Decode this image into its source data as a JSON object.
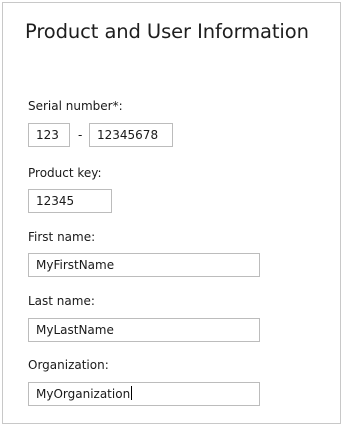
{
  "window": {
    "title": "Product and User Information"
  },
  "serial": {
    "label": "Serial number*:",
    "part1": "123",
    "separator": "-",
    "part2": "12345678"
  },
  "product_key": {
    "label": "Product key:",
    "value": "12345"
  },
  "first_name": {
    "label": "First name:",
    "value": "MyFirstName"
  },
  "last_name": {
    "label": "Last name:",
    "value": "MyLastName"
  },
  "organization": {
    "label": "Organization:",
    "value": "MyOrganization"
  }
}
